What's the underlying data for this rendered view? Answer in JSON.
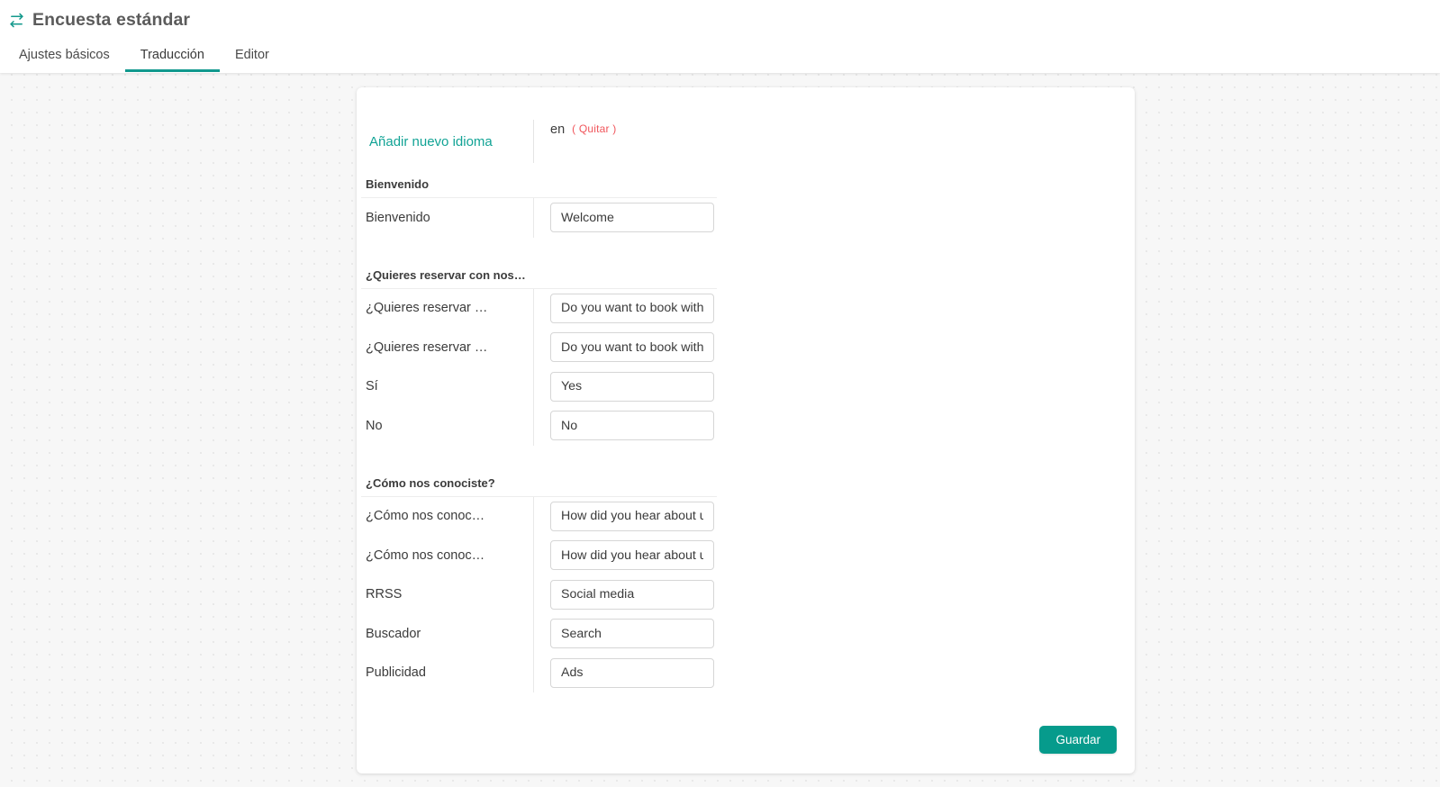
{
  "header": {
    "icon": "swap-arrows-icon",
    "title": "Encuesta estándar",
    "tabs": [
      {
        "label": "Ajustes básicos",
        "active": false
      },
      {
        "label": "Traducción",
        "active": true
      },
      {
        "label": "Editor",
        "active": false
      }
    ]
  },
  "language_bar": {
    "add_language_label": "Añadir nuevo idioma",
    "languages": [
      {
        "code": "en",
        "remove_label": "( Quitar )"
      }
    ]
  },
  "sections": [
    {
      "title": "Bienvenido",
      "rows": [
        {
          "label": "Bienvenido",
          "value": "Welcome"
        }
      ]
    },
    {
      "title": "¿Quieres reservar con nos…",
      "rows": [
        {
          "label": "¿Quieres reservar …",
          "value": "Do you want to book with us?"
        },
        {
          "label": "¿Quieres reservar …",
          "value": "Do you want to book with us?"
        },
        {
          "label": "Sí",
          "value": "Yes"
        },
        {
          "label": "No",
          "value": "No"
        }
      ]
    },
    {
      "title": "¿Cómo nos conociste?",
      "rows": [
        {
          "label": "¿Cómo nos conoc…",
          "value": "How did you hear about us?"
        },
        {
          "label": "¿Cómo nos conoc…",
          "value": "How did you hear about us?"
        },
        {
          "label": "RRSS",
          "value": "Social media"
        },
        {
          "label": "Buscador",
          "value": "Search"
        },
        {
          "label": "Publicidad",
          "value": "Ads"
        }
      ]
    }
  ],
  "footer": {
    "save_label": "Guardar"
  },
  "colors": {
    "accent_teal": "#11998e",
    "link_teal": "#11a395",
    "danger_red": "#f0555b",
    "save_button": "#069b8c",
    "page_background": "#f7f7f7",
    "card_background": "#ffffff",
    "text_primary": "#3b3b3b",
    "title_gray": "#5b5b5b"
  }
}
